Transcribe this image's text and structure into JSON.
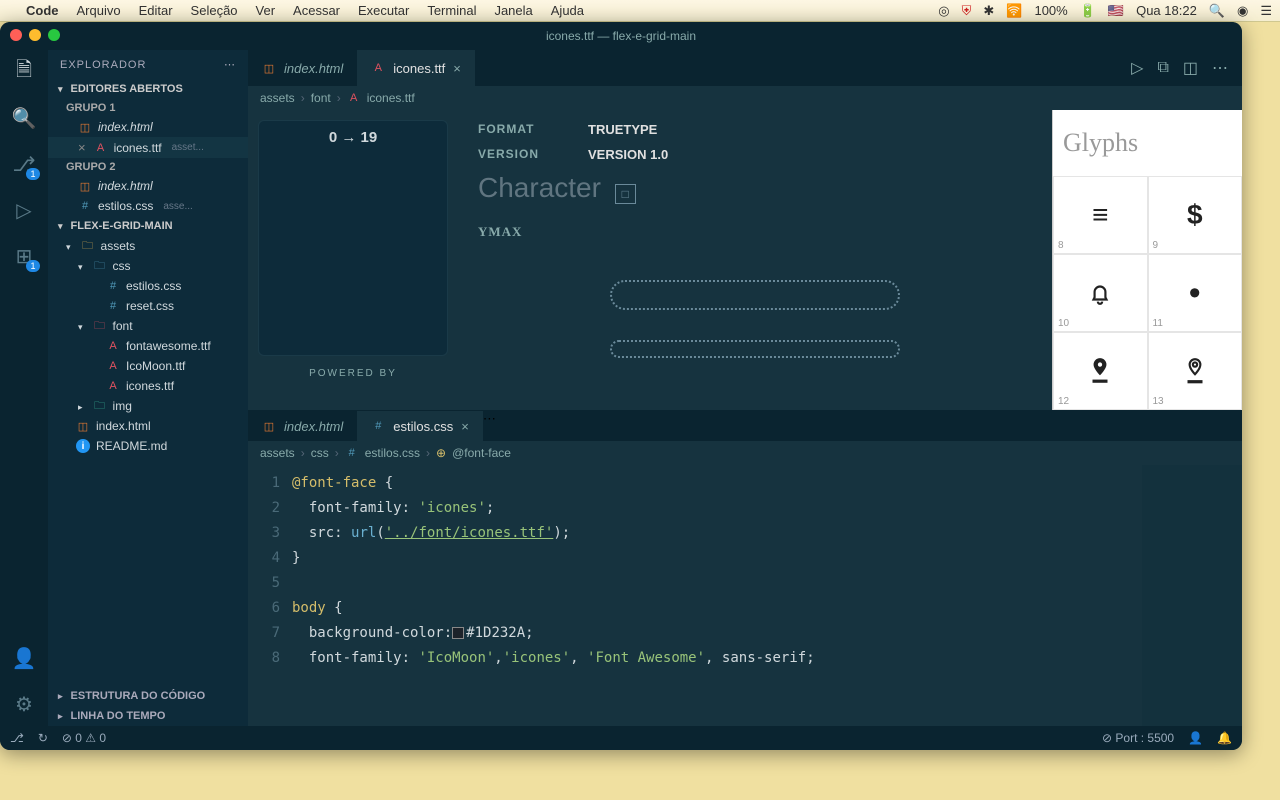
{
  "menubar": {
    "app": "Code",
    "items": [
      "Arquivo",
      "Editar",
      "Seleção",
      "Ver",
      "Acessar",
      "Executar",
      "Terminal",
      "Janela",
      "Ajuda"
    ],
    "battery": "100%",
    "clock": "Qua 18:22"
  },
  "window": {
    "title": "icones.ttf — flex-e-grid-main"
  },
  "sidebar": {
    "title": "EXPLORADOR",
    "open_editors": "EDITORES ABERTOS",
    "group1": "GRUPO 1",
    "group2": "GRUPO 2",
    "g1_items": [
      {
        "icon": "html",
        "label": "index.html"
      },
      {
        "icon": "font",
        "label": "icones.ttf",
        "dim": "asset..."
      }
    ],
    "g2_items": [
      {
        "icon": "html",
        "label": "index.html"
      },
      {
        "icon": "css",
        "label": "estilos.css",
        "dim": "asse..."
      }
    ],
    "project": "FLEX-E-GRID-MAIN",
    "tree": {
      "assets": "assets",
      "css": "css",
      "css_files": [
        "estilos.css",
        "reset.css"
      ],
      "font": "font",
      "font_files": [
        "fontawesome.ttf",
        "IcoMoon.ttf",
        "icones.ttf"
      ],
      "img": "img",
      "index": "index.html",
      "readme": "README.md"
    },
    "outline": "ESTRUTURA DO CÓDIGO",
    "timeline": "LINHA DO TEMPO"
  },
  "tabs1": {
    "t1": "index.html",
    "t2": "icones.ttf"
  },
  "breadcrumb1": [
    "assets",
    "font",
    "icones.ttf"
  ],
  "fontview": {
    "range": "0 → 19",
    "powered": "POWERED BY",
    "format_k": "FORMAT",
    "format_v": "TRUETYPE",
    "version_k": "VERSION",
    "version_v": "VERSION 1.0",
    "character": "Character",
    "charbox": "□",
    "ymax": "YMAX",
    "glyphs_title": "Glyphs",
    "glyphs": [
      {
        "n": "8",
        "g": "≡"
      },
      {
        "n": "9",
        "g": "$"
      },
      {
        "n": "10",
        "g": "bell"
      },
      {
        "n": "11",
        "g": "●"
      },
      {
        "n": "12",
        "g": "pin-fill"
      },
      {
        "n": "13",
        "g": "pin-outline"
      }
    ]
  },
  "tabs2": {
    "t1": "index.html",
    "t2": "estilos.css"
  },
  "breadcrumb2": [
    "assets",
    "css",
    "estilos.css",
    "@font-face"
  ],
  "code": {
    "lines": [
      "1",
      "2",
      "3",
      "4",
      "5",
      "6",
      "7",
      "8"
    ],
    "l1a": "@font-face",
    "l1b": " {",
    "l2a": "font-family",
    "l2b": ": ",
    "l2c": "'icones'",
    "l2d": ";",
    "l3a": "src",
    "l3b": ": ",
    "l3c": "url",
    "l3d": "(",
    "l3e": "'../font/icones.ttf'",
    "l3f": ");",
    "l4": "}",
    "l6a": "body",
    "l6b": " {",
    "l7a": "background-color",
    "l7b": ":",
    "l7c": "#1D232A",
    "l7d": ";",
    "l8a": "font-family",
    "l8b": ": ",
    "l8c": "'IcoMoon'",
    "l8d": ",",
    "l8e": "'icones'",
    "l8f": ", ",
    "l8g": "'Font Awesome'",
    "l8h": ", sans-serif;"
  },
  "status": {
    "branch": "⎇",
    "sync": "↻",
    "errors": "0",
    "warnings": "0",
    "port": "⊘ Port : 5500"
  }
}
